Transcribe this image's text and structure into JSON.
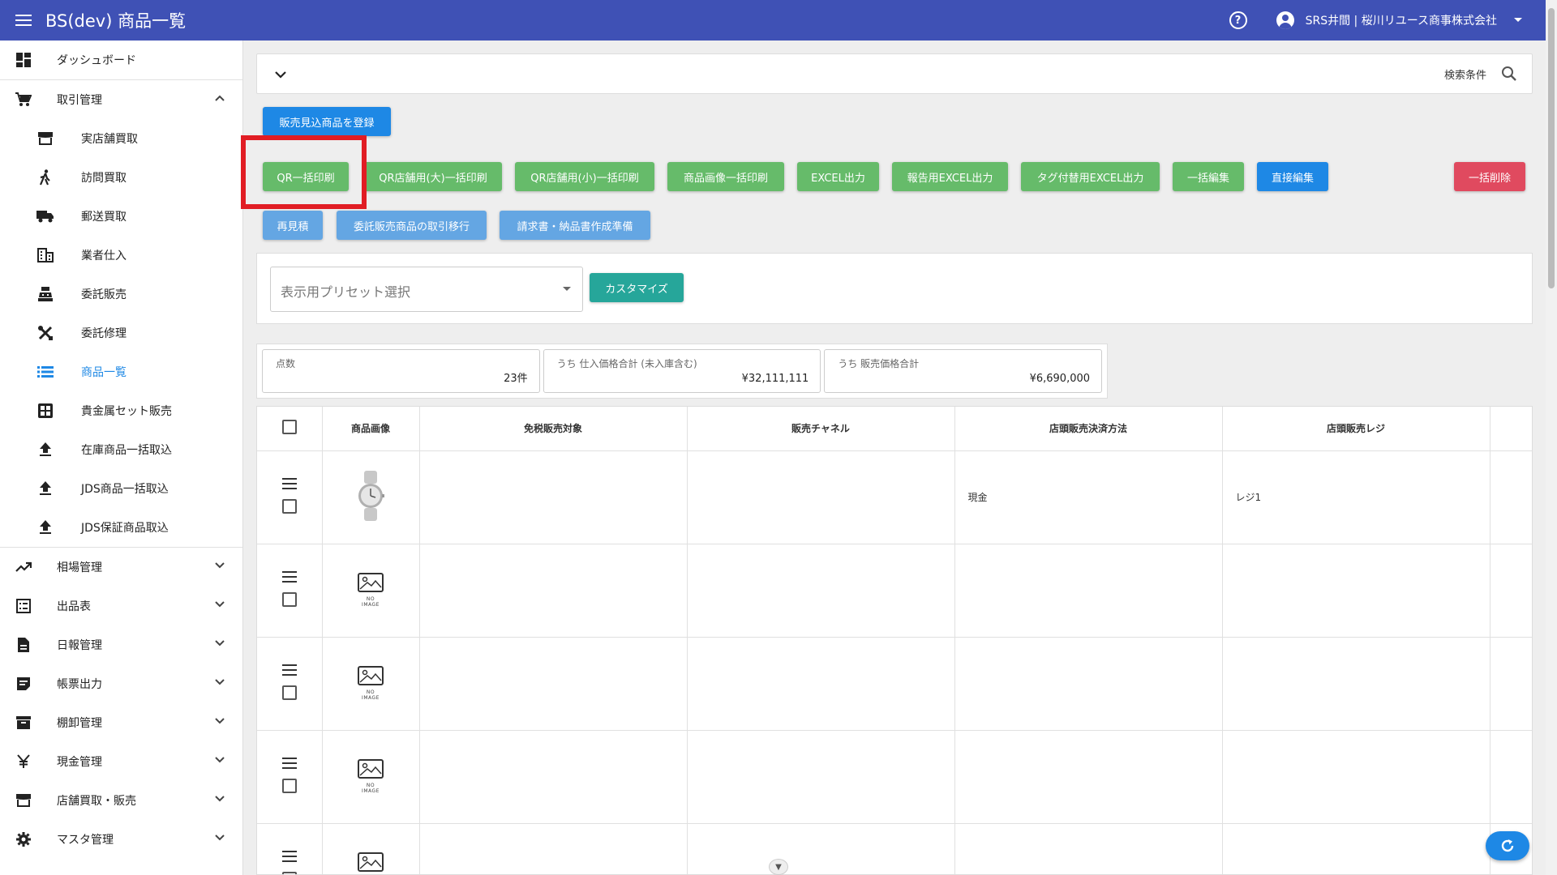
{
  "header": {
    "title": "BS(dev) 商品一覧",
    "user": "SRS井間 | 桜川リユース商事株式会社"
  },
  "sidebar": {
    "top": [
      {
        "label": "ダッシュボード",
        "icon": "dashboard-icon"
      },
      {
        "label": "取引管理",
        "icon": "cart-icon"
      }
    ],
    "sub": [
      {
        "label": "実店舗買取",
        "icon": "store-icon"
      },
      {
        "label": "訪問買取",
        "icon": "walk-icon"
      },
      {
        "label": "郵送買取",
        "icon": "truck-icon"
      },
      {
        "label": "業者仕入",
        "icon": "building-icon"
      },
      {
        "label": "委託販売",
        "icon": "register-icon"
      },
      {
        "label": "委託修理",
        "icon": "tools-icon"
      },
      {
        "label": "商品一覧",
        "icon": "list-icon"
      },
      {
        "label": "貴金属セット販売",
        "icon": "grid-icon"
      },
      {
        "label": "在庫商品一括取込",
        "icon": "upload-icon"
      },
      {
        "label": "JDS商品一括取込",
        "icon": "upload-icon"
      },
      {
        "label": "JDS保証商品取込",
        "icon": "upload-icon"
      }
    ],
    "groups": [
      {
        "label": "相場管理",
        "icon": "trend-icon"
      },
      {
        "label": "出品表",
        "icon": "listalt-icon"
      },
      {
        "label": "日報管理",
        "icon": "doc-icon"
      },
      {
        "label": "帳票出力",
        "icon": "note-icon"
      },
      {
        "label": "棚卸管理",
        "icon": "archive-icon"
      },
      {
        "label": "現金管理",
        "icon": "yen-icon"
      },
      {
        "label": "店舗買取・販売",
        "icon": "store-icon"
      },
      {
        "label": "マスタ管理",
        "icon": "gear-icon"
      }
    ]
  },
  "search": {
    "label": "検索条件"
  },
  "buttons": {
    "register": "販売見込商品を登録",
    "qr_all": "QR一括印刷",
    "qr_large": "QR店舗用(大)一括印刷",
    "qr_small": "QR店舗用(小)一括印刷",
    "image_print": "商品画像一括印刷",
    "excel": "EXCEL出力",
    "report_excel": "報告用EXCEL出力",
    "tag_excel": "タグ付替用EXCEL出力",
    "bulk_edit": "一括編集",
    "direct_edit": "直接編集",
    "bulk_delete": "一括削除",
    "reestimate": "再見積",
    "consign_transfer": "委託販売商品の取引移行",
    "invoice": "請求書・納品書作成準備",
    "customize": "カスタマイズ"
  },
  "preset": {
    "placeholder": "表示用プリセット選択"
  },
  "stats": [
    {
      "label": "点数",
      "value": "23件"
    },
    {
      "label": "うち 仕入価格合計 (未入庫含む)",
      "value": "¥32,111,111"
    },
    {
      "label": "うち 販売価格合計",
      "value": "¥6,690,000"
    }
  ],
  "table": {
    "headers": [
      "商品画像",
      "免税販売対象",
      "販売チャネル",
      "店頭販売決済方法",
      "店頭販売レジ"
    ],
    "no_image": "NO IMAGE",
    "rows": [
      {
        "payment": "現金",
        "register": "レジ1"
      },
      {
        "payment": "",
        "register": ""
      },
      {
        "payment": "",
        "register": ""
      },
      {
        "payment": "",
        "register": ""
      },
      {
        "payment": "",
        "register": ""
      }
    ]
  }
}
